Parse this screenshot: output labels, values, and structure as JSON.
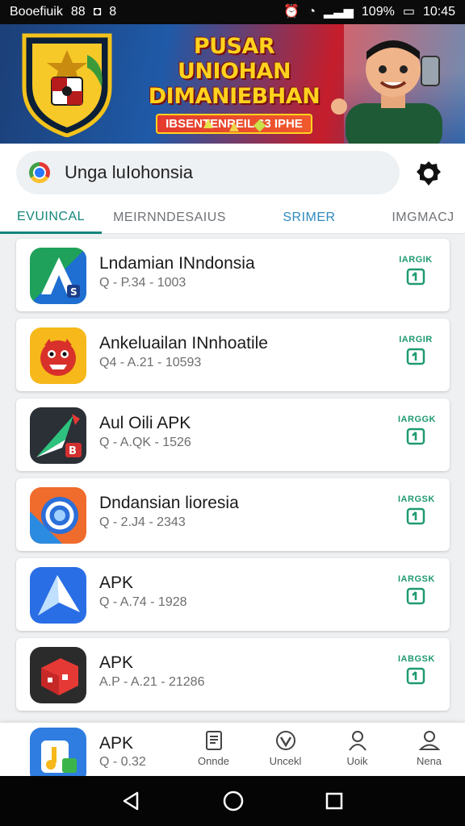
{
  "status_bar": {
    "left_text": "Booefiuik",
    "left_icon1": "88",
    "right_battery": "109%",
    "time": "10:45"
  },
  "banner": {
    "title_line1": "PUSAR UNIOHAN",
    "title_line2": "DIMANIEBHAN",
    "subtitle": "IBSENTENREIL 63 IPHE"
  },
  "search": {
    "value": "Unga luIohonsia"
  },
  "tabs": [
    {
      "label": "EVUINCAL"
    },
    {
      "label": "MEIRNNDESAIUS"
    },
    {
      "label": "SRIMER"
    },
    {
      "label": "IMGMACJ"
    }
  ],
  "apps": [
    {
      "name": "Lndamian INndonsia",
      "meta": "Q - P.34 - 1003",
      "install_label": "IARGIK",
      "icon": "green-blue-arrow-icon"
    },
    {
      "name": "Ankeluailan INnhoatile",
      "meta": "Q4 - A.21 - 10593",
      "install_label": "IARGIR",
      "icon": "red-monster-icon"
    },
    {
      "name": "Aul Oili APK",
      "meta": "Q - A.QK - 1526",
      "install_label": "IARGGK",
      "icon": "dark-arrow-icon"
    },
    {
      "name": "Dndansian lioresia",
      "meta": "Q - 2.J4 - 2343",
      "install_label": "IARGSK",
      "icon": "circle-orange-icon"
    },
    {
      "name": "APK",
      "meta": "Q - A.74 - 1928",
      "install_label": "IARGSK",
      "icon": "blue-arrow-icon"
    },
    {
      "name": "APK",
      "meta": "A.P - A.21 - 21286",
      "install_label": "IABGSK",
      "icon": "red-cube-icon"
    }
  ],
  "bottom_card": {
    "name": "APK",
    "meta": "Q - 0.32"
  },
  "bottom_nav": [
    {
      "label": "Onnde",
      "icon": "document-icon"
    },
    {
      "label": "Uncekl",
      "icon": "shield-check-icon"
    },
    {
      "label": "Uoik",
      "icon": "person-icon"
    },
    {
      "label": "Nena",
      "icon": "profile-icon"
    }
  ]
}
